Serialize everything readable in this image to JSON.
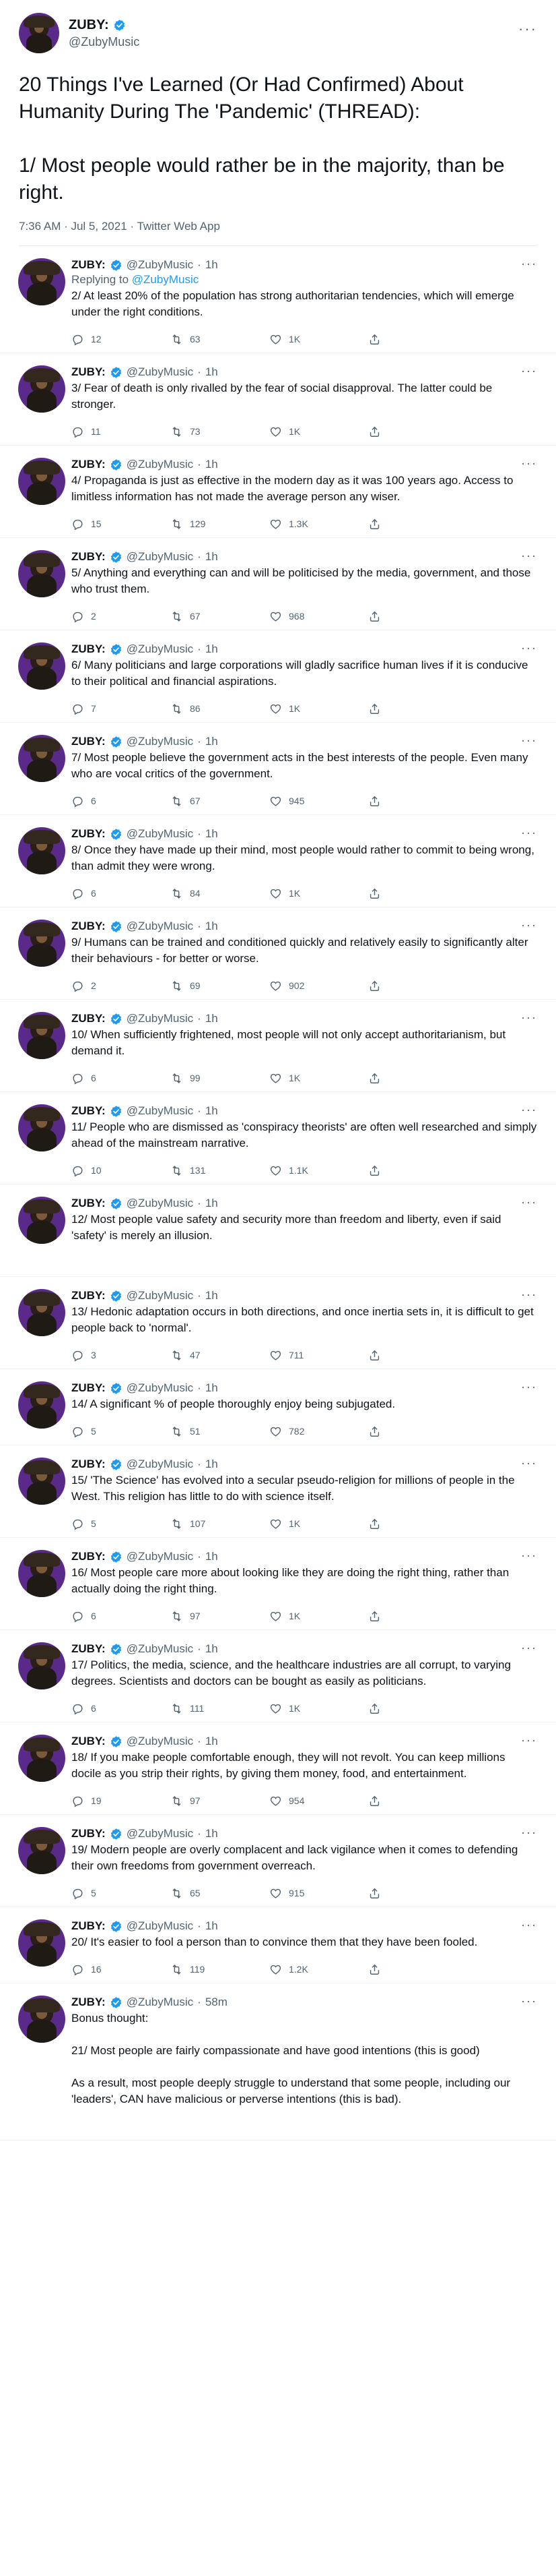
{
  "main": {
    "display_name": "ZUBY:",
    "handle": "@ZubyMusic",
    "text": "20 Things I've Learned (Or Had Confirmed) About Humanity During The 'Pandemic' (THREAD):\n\n1/ Most people would rather be in the majority, than be right.",
    "meta": "7:36 AM · Jul 5, 2021 · Twitter Web App"
  },
  "replying_to_label": "Replying to",
  "replying_to_handle": "@ZubyMusic",
  "replies": [
    {
      "name": "ZUBY:",
      "handle": "@ZubyMusic",
      "dot": "·",
      "time": "1h",
      "text": "2/ At least 20% of the population has strong authoritarian tendencies, which will emerge under the right conditions.",
      "replies": "12",
      "retweets": "63",
      "likes": "1K"
    },
    {
      "name": "ZUBY:",
      "handle": "@ZubyMusic",
      "dot": "·",
      "time": "1h",
      "text": "3/ Fear of death is only rivalled by the fear of social disapproval. The latter could be stronger.",
      "replies": "11",
      "retweets": "73",
      "likes": "1K"
    },
    {
      "name": "ZUBY:",
      "handle": "@ZubyMusic",
      "dot": "·",
      "time": "1h",
      "text": "4/ Propaganda is just as effective in the modern day as it was 100 years ago. Access to limitless information has not made the average person any wiser.",
      "replies": "15",
      "retweets": "129",
      "likes": "1.3K"
    },
    {
      "name": "ZUBY:",
      "handle": "@ZubyMusic",
      "dot": "·",
      "time": "1h",
      "text": "5/ Anything and everything can and will be politicised by the media, government, and those who trust them.",
      "replies": "2",
      "retweets": "67",
      "likes": "968"
    },
    {
      "name": "ZUBY:",
      "handle": "@ZubyMusic",
      "dot": "·",
      "time": "1h",
      "text": "6/ Many politicians and large corporations will gladly sacrifice human lives if it is conducive to their political and financial aspirations.",
      "replies": "7",
      "retweets": "86",
      "likes": "1K"
    },
    {
      "name": "ZUBY:",
      "handle": "@ZubyMusic",
      "dot": "·",
      "time": "1h",
      "text": "7/ Most people believe the government acts in the best interests of the people. Even many who are vocal critics of the government.",
      "replies": "6",
      "retweets": "67",
      "likes": "945"
    },
    {
      "name": "ZUBY:",
      "handle": "@ZubyMusic",
      "dot": "·",
      "time": "1h",
      "text": "8/ Once they have made up their mind, most people would rather to commit to being wrong, than admit they were wrong.",
      "replies": "6",
      "retweets": "84",
      "likes": "1K"
    },
    {
      "name": "ZUBY:",
      "handle": "@ZubyMusic",
      "dot": "·",
      "time": "1h",
      "text": "9/ Humans can be trained and conditioned quickly and relatively easily to significantly alter their behaviours - for better or worse.",
      "replies": "2",
      "retweets": "69",
      "likes": "902"
    },
    {
      "name": "ZUBY:",
      "handle": "@ZubyMusic",
      "dot": "·",
      "time": "1h",
      "text": "10/ When sufficiently frightened, most people will not only accept authoritarianism, but demand it.",
      "replies": "6",
      "retweets": "99",
      "likes": "1K"
    },
    {
      "name": "ZUBY:",
      "handle": "@ZubyMusic",
      "dot": "·",
      "time": "1h",
      "text": "11/ People who are dismissed as 'conspiracy theorists' are often well researched and simply ahead of the mainstream narrative.",
      "replies": "10",
      "retweets": "131",
      "likes": "1.1K"
    },
    {
      "name": "ZUBY:",
      "handle": "@ZubyMusic",
      "dot": "·",
      "time": "1h",
      "text": "12/ Most people value safety and security more than freedom and liberty, even if said 'safety' is merely an illusion.",
      "replies": "",
      "retweets": "",
      "likes": "",
      "noactions": true
    },
    {
      "name": "ZUBY:",
      "handle": "@ZubyMusic",
      "dot": "·",
      "time": "1h",
      "text": "13/ Hedonic adaptation occurs in both directions, and once inertia sets in, it is difficult to get people back to 'normal'.",
      "replies": "3",
      "retweets": "47",
      "likes": "711"
    },
    {
      "name": "ZUBY:",
      "handle": "@ZubyMusic",
      "dot": "·",
      "time": "1h",
      "text": "14/ A significant % of people thoroughly enjoy being subjugated.",
      "replies": "5",
      "retweets": "51",
      "likes": "782"
    },
    {
      "name": "ZUBY:",
      "handle": "@ZubyMusic",
      "dot": "·",
      "time": "1h",
      "text": "15/ 'The Science' has evolved into a secular pseudo-religion for millions of people in the West. This religion has little to do with science itself.",
      "replies": "5",
      "retweets": "107",
      "likes": "1K"
    },
    {
      "name": "ZUBY:",
      "handle": "@ZubyMusic",
      "dot": "·",
      "time": "1h",
      "text": "16/ Most people care more about looking like they are doing the right thing, rather than actually doing the right thing.",
      "replies": "6",
      "retweets": "97",
      "likes": "1K"
    },
    {
      "name": "ZUBY:",
      "handle": "@ZubyMusic",
      "dot": "·",
      "time": "1h",
      "text": "17/ Politics, the media, science, and the healthcare industries are all corrupt, to varying degrees. Scientists and doctors can be bought as easily as politicians.",
      "replies": "6",
      "retweets": "111",
      "likes": "1K"
    },
    {
      "name": "ZUBY:",
      "handle": "@ZubyMusic",
      "dot": "·",
      "time": "1h",
      "text": "18/ If you make people comfortable enough, they will not revolt. You can keep millions docile as you strip their rights, by giving them money, food, and entertainment.",
      "replies": "19",
      "retweets": "97",
      "likes": "954"
    },
    {
      "name": "ZUBY:",
      "handle": "@ZubyMusic",
      "dot": "·",
      "time": "1h",
      "text": "19/ Modern people are overly complacent and lack vigilance when it comes to defending their own freedoms from government overreach.",
      "replies": "5",
      "retweets": "65",
      "likes": "915"
    },
    {
      "name": "ZUBY:",
      "handle": "@ZubyMusic",
      "dot": "·",
      "time": "1h",
      "text": "20/ It's easier to fool a person than to convince them that they have been fooled.",
      "replies": "16",
      "retweets": "119",
      "likes": "1.2K"
    },
    {
      "name": "ZUBY:",
      "handle": "@ZubyMusic",
      "dot": "·",
      "time": "58m",
      "text": "Bonus thought:\n\n21/ Most people are fairly compassionate and have good intentions (this is good)\n\nAs a result, most people deeply struggle to understand that some people, including our 'leaders', CAN have malicious or perverse intentions (this is bad).",
      "replies": "",
      "retweets": "",
      "likes": "",
      "noactions": true
    }
  ],
  "icons": {
    "verified": "verified-badge-icon",
    "reply": "reply-icon",
    "retweet": "retweet-icon",
    "like": "heart-icon",
    "share": "share-icon",
    "more": "more-icon"
  },
  "colors": {
    "accent": "#1d9bf0",
    "secondary_text": "#536471",
    "avatar_bg": "#5a2a8a"
  }
}
